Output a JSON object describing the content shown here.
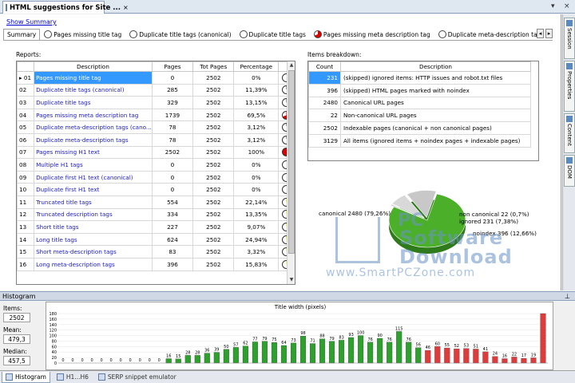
{
  "doc_tab": {
    "title": "HTML suggestions for Site ...",
    "close": "×"
  },
  "strip_buttons": {
    "down": "▾",
    "close": "×"
  },
  "show_summary": "Show Summary",
  "report_tabs": [
    {
      "label": "Summary",
      "icon": "",
      "active": true
    },
    {
      "label": "Pages missing title tag",
      "icon": "pie-empty"
    },
    {
      "label": "Duplicate title tags (canonical)",
      "icon": "pie-empty"
    },
    {
      "label": "Duplicate title tags",
      "icon": "pie-empty"
    },
    {
      "label": "Pages missing meta description tag",
      "icon": "pie-red"
    },
    {
      "label": "Duplicate meta-description tags (canonical)",
      "icon": "pie-empty"
    },
    {
      "label": "Duplicate meta-descriptio",
      "icon": "pie-empty"
    }
  ],
  "tab_scroll": {
    "left": "◂",
    "right": "▸"
  },
  "reports": {
    "label": "Reports:",
    "columns": [
      "",
      "Description",
      "Pages",
      "Tot Pages",
      "Percentage",
      ""
    ],
    "rows": [
      {
        "n": "01",
        "desc": "Pages missing title tag",
        "pages": "0",
        "tot": "2502",
        "pct": "0%",
        "fill": 0,
        "selected": true
      },
      {
        "n": "02",
        "desc": "Duplicate title tags (canonical)",
        "pages": "285",
        "tot": "2502",
        "pct": "11,39%",
        "fill": 0.1139
      },
      {
        "n": "03",
        "desc": "Duplicate title tags",
        "pages": "329",
        "tot": "2502",
        "pct": "13,15%",
        "fill": 0.1315
      },
      {
        "n": "04",
        "desc": "Pages missing meta description tag",
        "pages": "1739",
        "tot": "2502",
        "pct": "69,5%",
        "fill": 0.695,
        "color": "#dd0000"
      },
      {
        "n": "05",
        "desc": "Duplicate meta-description tags (cano...",
        "pages": "78",
        "tot": "2502",
        "pct": "3,12%",
        "fill": 0.0312
      },
      {
        "n": "06",
        "desc": "Duplicate meta-description tags",
        "pages": "78",
        "tot": "2502",
        "pct": "3,12%",
        "fill": 0.0312
      },
      {
        "n": "07",
        "desc": "Pages missing H1 text",
        "pages": "2502",
        "tot": "2502",
        "pct": "100%",
        "fill": 1,
        "color": "#dd0000"
      },
      {
        "n": "08",
        "desc": "Multiple H1 tags",
        "pages": "0",
        "tot": "2502",
        "pct": "0%",
        "fill": 0
      },
      {
        "n": "09",
        "desc": "Duplicate first H1 text (canonical)",
        "pages": "0",
        "tot": "2502",
        "pct": "0%",
        "fill": 0
      },
      {
        "n": "10",
        "desc": "Duplicate first H1 text",
        "pages": "0",
        "tot": "2502",
        "pct": "0%",
        "fill": 0
      },
      {
        "n": "11",
        "desc": "Truncated title tags",
        "pages": "554",
        "tot": "2502",
        "pct": "22,14%",
        "fill": 0.2214,
        "color": "#e8e800"
      },
      {
        "n": "12",
        "desc": "Truncated description tags",
        "pages": "334",
        "tot": "2502",
        "pct": "13,35%",
        "fill": 0.1335,
        "color": "#e8e800"
      },
      {
        "n": "13",
        "desc": "Short title tags",
        "pages": "227",
        "tot": "2502",
        "pct": "9,07%",
        "fill": 0.0907,
        "color": "#e8e800"
      },
      {
        "n": "14",
        "desc": "Long title tags",
        "pages": "624",
        "tot": "2502",
        "pct": "24,94%",
        "fill": 0.2494,
        "color": "#e8e800"
      },
      {
        "n": "15",
        "desc": "Short meta-description tags",
        "pages": "83",
        "tot": "2502",
        "pct": "3,32%",
        "fill": 0.0332,
        "color": "#e8e800"
      },
      {
        "n": "16",
        "desc": "Long meta-description tags",
        "pages": "396",
        "tot": "2502",
        "pct": "15,83%",
        "fill": 0.1583,
        "color": "#e8e800"
      }
    ]
  },
  "breakdown": {
    "label": "Items breakdown:",
    "columns": [
      "Count",
      "Description"
    ],
    "rows": [
      {
        "count": "231",
        "desc": "(skipped) ignored items: HTTP issues and robot.txt files",
        "selected": true
      },
      {
        "count": "396",
        "desc": "(skipped) HTML pages marked with noindex"
      },
      {
        "count": "2480",
        "desc": "Canonical URL pages"
      },
      {
        "count": "22",
        "desc": "Non-canonical URL pages"
      },
      {
        "count": "2502",
        "desc": "Indexable pages (canonical + non canonical pages)"
      },
      {
        "count": "3129",
        "desc": "All items (ignored items + noindex pages + indexable pages)"
      }
    ]
  },
  "pie": {
    "labels": {
      "canonical": "canonical 2480 (79,26%)",
      "noncanonical": "non canonical 22 (0,7%)",
      "ignored": "ignored 231 (7,38%)",
      "noindex": "noindex 396 (12,66%)"
    },
    "values": [
      2480,
      22,
      231,
      396
    ],
    "colors": [
      "#4caf2a",
      "#b8b8b8",
      "#d8d8d8",
      "#c8c8c8"
    ]
  },
  "watermark": {
    "pc": "PC",
    "software": "Software",
    "download": "Download",
    "url": "www.SmartPCZone.com"
  },
  "side_tabs": [
    "Session",
    "Properties",
    "Content",
    "DOM"
  ],
  "histogram": {
    "header": "Histogram",
    "pin": "⊥",
    "items_label": "Items:",
    "items_value": "2502",
    "mean_label": "Mean:",
    "mean_value": "479,3",
    "median_label": "Median:",
    "median_value": "457,5"
  },
  "chart_data": {
    "type": "bar",
    "title": "Title width (pixels)",
    "ylim": [
      0,
      180
    ],
    "yticks": [
      0,
      20,
      40,
      60,
      80,
      100,
      120,
      140,
      160,
      180
    ],
    "values": [
      0,
      0,
      0,
      0,
      0,
      0,
      0,
      0,
      0,
      0,
      0,
      16,
      15,
      28,
      28,
      36,
      39,
      50,
      57,
      62,
      77,
      79,
      75,
      64,
      73,
      98,
      71,
      88,
      79,
      83,
      93,
      100,
      76,
      90,
      76,
      115,
      76,
      56,
      46,
      60,
      55,
      52,
      53,
      51,
      41,
      24,
      16,
      22,
      17,
      19,
      180
    ],
    "value_labels": [
      "0",
      "0",
      "0",
      "0",
      "0",
      "0",
      "0",
      "0",
      "0",
      "0",
      "0",
      "16",
      "15",
      "28",
      "28",
      "36",
      "39",
      "50",
      "57",
      "62",
      "77",
      "79",
      "75",
      "64",
      "73",
      "98",
      "71",
      "88",
      "79",
      "83",
      "93",
      "100",
      "76",
      "90",
      "76",
      "115",
      "76",
      "56",
      "46",
      "60",
      "55",
      "52",
      "53",
      "51",
      "41",
      "24",
      "16",
      "22",
      "17",
      "19",
      ""
    ],
    "green_count": 38,
    "green": "#2ea02e",
    "red": "#e03a3a"
  },
  "bottom_tabs": [
    {
      "label": "Histogram",
      "active": true
    },
    {
      "label": "H1...H6"
    },
    {
      "label": "SERP snippet emulator"
    }
  ]
}
